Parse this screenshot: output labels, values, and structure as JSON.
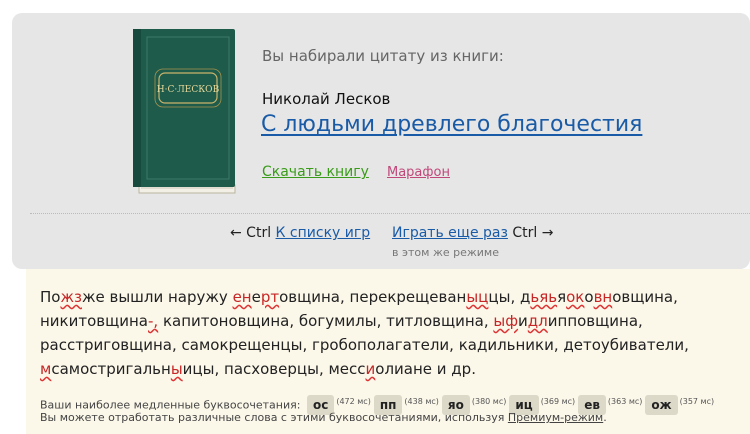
{
  "book": {
    "cover_text": "Н·С·ЛЕСКОВ",
    "intro": "Вы набирали цитату из книги:",
    "author": "Николай Лесков",
    "title": "С людьми древлего благочестия",
    "download_label": "Скачать книгу",
    "marathon_label": "Марафон",
    "colors": {
      "cover": "#1f5b4b",
      "link": "#1a5ba7",
      "download": "#3a9b1a",
      "marathon": "#c0477a"
    }
  },
  "nav": {
    "back_ctrl": "← Ctrl",
    "to_list": "К списку игр",
    "play_again": "Играть еще раз",
    "fwd_ctrl": "Ctrl →",
    "mode_note": "в этом же режиме"
  },
  "quote": {
    "segments": [
      {
        "t": "По"
      },
      {
        "t": "жз",
        "err": true
      },
      {
        "t": "же вышли наружу "
      },
      {
        "t": "ен",
        "err": true
      },
      {
        "t": "е"
      },
      {
        "t": "рт",
        "err": true
      },
      {
        "t": "овщина, перекрещеван"
      },
      {
        "t": "ыц",
        "err": true
      },
      {
        "t": "цы, д"
      },
      {
        "t": "ьяь",
        "err": true
      },
      {
        "t": "я"
      },
      {
        "t": "ок",
        "err": true
      },
      {
        "t": "о"
      },
      {
        "t": "вн",
        "err": true
      },
      {
        "t": "овщина, никитовщина"
      },
      {
        "t": "-,",
        "err": true
      },
      {
        "t": " капитоновщина, богумилы, титловщина, "
      },
      {
        "t": "ыф",
        "err": true
      },
      {
        "t": "и"
      },
      {
        "t": "дл",
        "err": true
      },
      {
        "t": "ипповщина, расстриговщина, самокрещенцы, гробополагатели, кадильники, детоубиватели, "
      },
      {
        "t": "м",
        "err": true
      },
      {
        "t": "самостригальн"
      },
      {
        "t": "ы",
        "err": true
      },
      {
        "t": "ицы, пасховерцы, месс"
      },
      {
        "t": "и",
        "err": true
      },
      {
        "t": "олиане и др."
      }
    ]
  },
  "stats": {
    "slowest_label": "Ваши наиболее медленные буквосочетания:",
    "pairs": [
      {
        "pair": "ос",
        "ms": "(472 мс)"
      },
      {
        "pair": "пп",
        "ms": "(438 мс)"
      },
      {
        "pair": "яо",
        "ms": "(380 мс)"
      },
      {
        "pair": "иц",
        "ms": "(369 мс)"
      },
      {
        "pair": "ев",
        "ms": "(363 мс)"
      },
      {
        "pair": "ож",
        "ms": "(357 мс)"
      }
    ],
    "practice_text": "Вы можете отработать различные слова с этими буквосочетаниями, используя ",
    "premium_label": "Премиум-режим",
    "practice_end": "."
  }
}
